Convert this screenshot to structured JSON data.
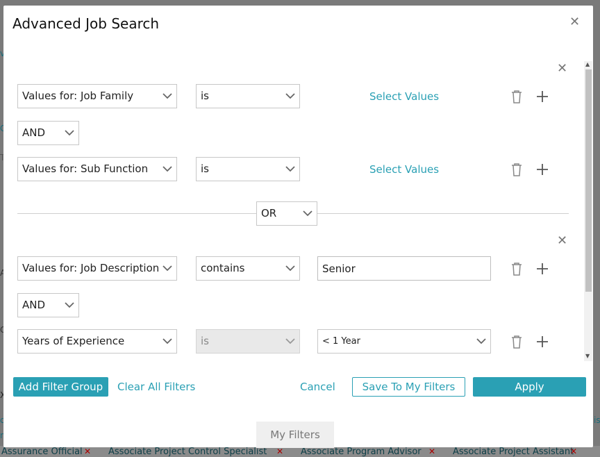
{
  "modal": {
    "title": "Advanced Job Search"
  },
  "groups": [
    {
      "rows": [
        {
          "field": "Values for:  Job Family",
          "operator": "is",
          "value_link": "Select Values"
        },
        {
          "connector": "AND"
        },
        {
          "field": "Values for:  Sub Function",
          "operator": "is",
          "value_link": "Select Values"
        }
      ]
    },
    {
      "connector": "OR"
    },
    {
      "rows": [
        {
          "field": "Values for:  Job Description",
          "operator": "contains",
          "value_input": "Senior"
        },
        {
          "connector": "AND"
        },
        {
          "field": "Years of Experience",
          "operator": "is",
          "value_select": "< 1 Year"
        }
      ]
    }
  ],
  "footer": {
    "add_group": "Add Filter Group",
    "clear_all": "Clear All Filters",
    "cancel": "Cancel",
    "save": "Save To My Filters",
    "apply": "Apply"
  },
  "my_filters_tab": "My Filters",
  "background": {
    "tags": [
      "Assurance Official",
      "Associate Project Control Specialist",
      "Associate Program Advisor",
      "Associate Project Assistant"
    ],
    "fragments": [
      "v",
      "C",
      "T",
      "Ac",
      "Cr",
      "X",
      "c",
      "n",
      "is"
    ]
  },
  "icons": {
    "delete": "trash-icon",
    "add": "plus-icon",
    "close": "close-icon",
    "dropdown": "chevron-down-icon"
  },
  "colors": {
    "accent": "#2aa0b4",
    "overlay": "#7a7a7a"
  }
}
